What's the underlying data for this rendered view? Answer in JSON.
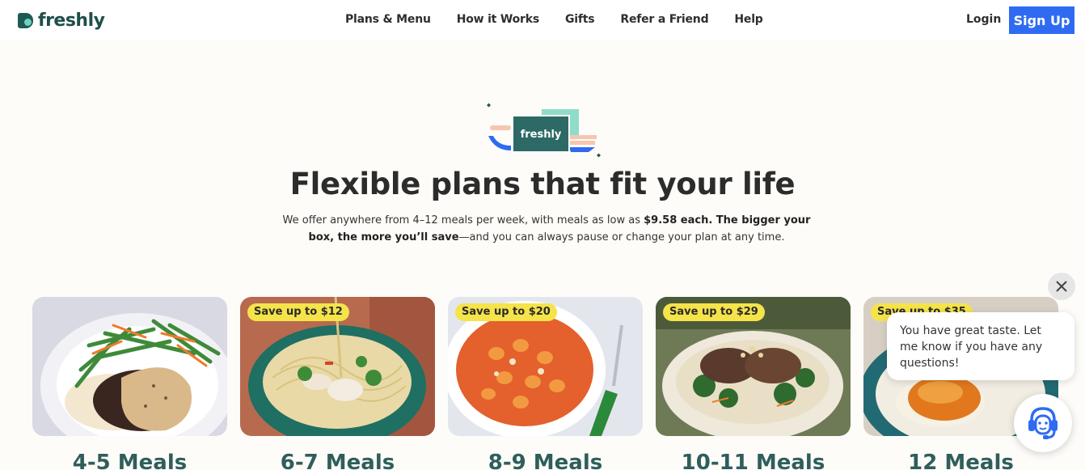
{
  "brand": {
    "name": "freshly",
    "illustration_text": "freshly"
  },
  "nav": {
    "items": [
      "Plans & Menu",
      "How it Works",
      "Gifts",
      "Refer a Friend",
      "Help"
    ],
    "login": "Login",
    "signup": "Sign Up"
  },
  "hero": {
    "title": "Flexible plans that fit your life",
    "sub_part1": "We offer anywhere from 4–12 meals per week, with meals as low as ",
    "sub_bold1": "$9.58 each. The bigger your box, the more you’ll save",
    "sub_part2": "—and you can always pause or change your plan at any time."
  },
  "plans": [
    {
      "label": "4-5 Meals",
      "badge": "",
      "dish": "steak-mashed-potatoes-green-beans"
    },
    {
      "label": "6-7 Meals",
      "badge": "Save up to $12",
      "dish": "chicken-noodle-bowl"
    },
    {
      "label": "8-9 Meals",
      "badge": "Save up to $20",
      "dish": "gnocchi-tomato-sauce"
    },
    {
      "label": "10-11 Meals",
      "badge": "Save up to $29",
      "dish": "pork-kale-rice-bowl"
    },
    {
      "label": "12 Meals",
      "badge": "Save up to $35",
      "dish": "chicken-mashed-potatoes"
    }
  ],
  "chat": {
    "message": "You have great taste. Let me know if you have any questions!",
    "close_icon": "close-icon",
    "launcher_icon": "support-agent-icon"
  },
  "colors": {
    "accent_blue": "#2f6bf2",
    "brand_green": "#1f5a55",
    "badge_yellow": "#f5e34a",
    "meal_label": "#2f5e5c",
    "background": "#fdfcf8"
  }
}
